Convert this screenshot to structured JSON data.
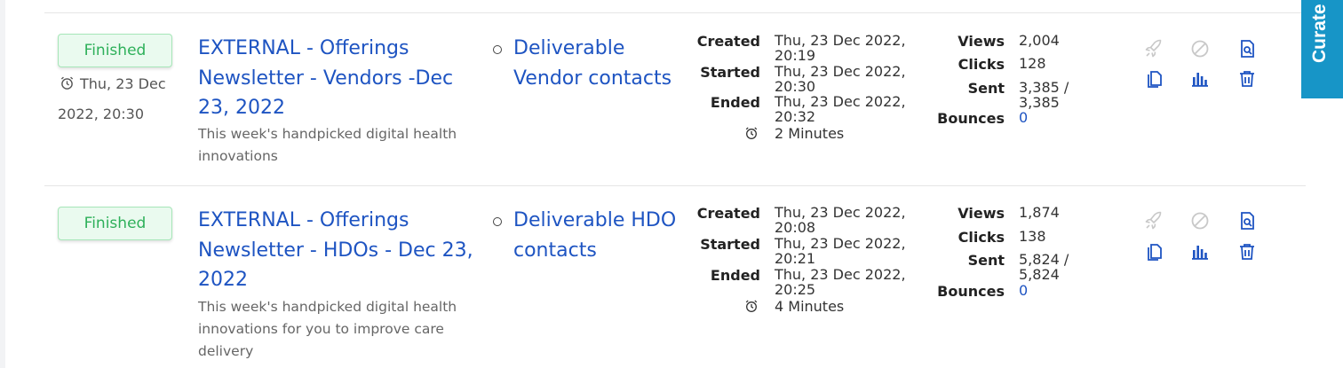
{
  "side_tab": {
    "label": "Curate"
  },
  "colors": {
    "link": "#1e54c2",
    "success_bg": "#eafaef",
    "success_text": "#2eb05a",
    "side_tab": "#1795c7",
    "disabled_icon": "#c8c8c8"
  },
  "rows": [
    {
      "status": "Finished",
      "scheduled_line1": "Thu, 23 Dec",
      "scheduled_line2": "2022, 20:30",
      "title_lines": [
        "EXTERNAL - Offerings",
        "Newsletter - Vendors -Dec",
        "23, 2022"
      ],
      "description_lines": [
        "This week's handpicked digital health",
        "innovations"
      ],
      "lists": [
        [
          "Deliverable",
          "Vendor contacts"
        ]
      ],
      "created_label": "Created",
      "created_lines": [
        "Thu, 23 Dec 2022,",
        "20:19"
      ],
      "started_label": "Started",
      "started_lines": [
        "Thu, 23 Dec 2022,",
        "20:30"
      ],
      "ended_label": "Ended",
      "ended_lines": [
        "Thu, 23 Dec 2022,",
        "20:32"
      ],
      "duration": "2 Minutes",
      "views_label": "Views",
      "views": "2,004",
      "clicks_label": "Clicks",
      "clicks": "128",
      "sent_label": "Sent",
      "sent_lines": [
        "3,385 /",
        "3,385"
      ],
      "bounces_label": "Bounces",
      "bounces": "0",
      "icons": [
        "rocket-icon",
        "cancel-icon",
        "preview-icon",
        "copy-icon",
        "stats-icon",
        "trash-icon"
      ]
    },
    {
      "status": "Finished",
      "title_lines": [
        "EXTERNAL - Offerings",
        "Newsletter - HDOs - Dec 23,",
        "2022"
      ],
      "description_lines": [
        "This week's handpicked digital health",
        "innovations for you to improve care",
        "delivery"
      ],
      "lists": [
        [
          "Deliverable HDO",
          "contacts"
        ]
      ],
      "created_label": "Created",
      "created_lines": [
        "Thu, 23 Dec 2022,",
        "20:08"
      ],
      "started_label": "Started",
      "started_lines": [
        "Thu, 23 Dec 2022,",
        "20:21"
      ],
      "ended_label": "Ended",
      "ended_lines": [
        "Thu, 23 Dec 2022,",
        "20:25"
      ],
      "duration": "4 Minutes",
      "views_label": "Views",
      "views": "1,874",
      "clicks_label": "Clicks",
      "clicks": "138",
      "sent_label": "Sent",
      "sent_lines": [
        "5,824 /",
        "5,824"
      ],
      "bounces_label": "Bounces",
      "bounces": "0",
      "icons": [
        "rocket-icon",
        "cancel-icon",
        "preview-icon",
        "copy-icon",
        "stats-icon",
        "trash-icon"
      ]
    }
  ]
}
